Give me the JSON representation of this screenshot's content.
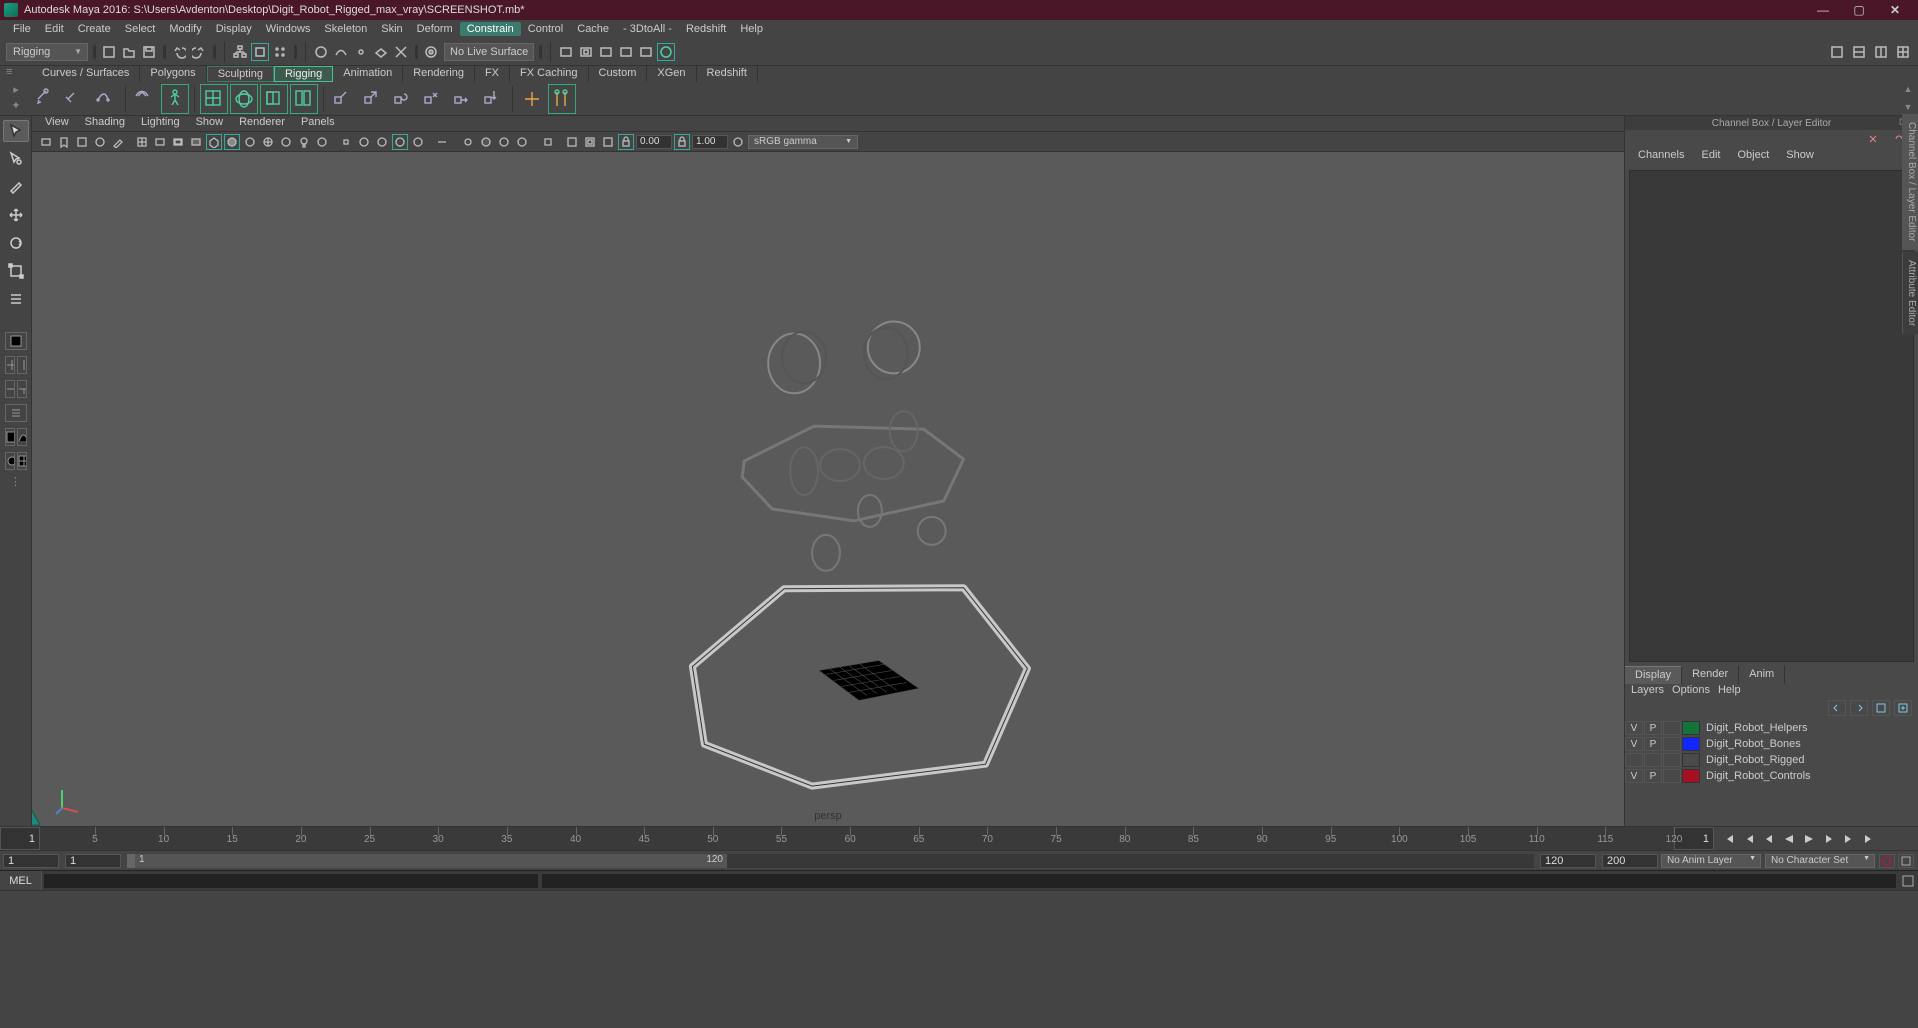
{
  "window": {
    "title": "Autodesk Maya 2016: S:\\Users\\Avdenton\\Desktop\\Digit_Robot_Rigged_max_vray\\SCREENSHOT.mb*"
  },
  "menubar": [
    "File",
    "Edit",
    "Create",
    "Select",
    "Modify",
    "Display",
    "Windows",
    "Skeleton",
    "Skin",
    "Deform",
    "Constrain",
    "Control",
    "Cache",
    "- 3DtoAll -",
    "Redshift",
    "Help"
  ],
  "menubar_highlight": "Constrain",
  "statusline": {
    "workspace": "Rigging",
    "live_surface": "No Live Surface"
  },
  "shelf_tabs": [
    "Curves / Surfaces",
    "Polygons",
    "Sculpting",
    "Rigging",
    "Animation",
    "Rendering",
    "FX",
    "FX Caching",
    "Custom",
    "XGen",
    "Redshift"
  ],
  "shelf_active": "Rigging",
  "vp_menu": [
    "View",
    "Shading",
    "Lighting",
    "Show",
    "Renderer",
    "Panels"
  ],
  "vp_toolbar": {
    "gamma_in": "0.00",
    "gamma_out": "1.00",
    "color_space": "sRGB gamma"
  },
  "camera_label": "persp",
  "channel_box": {
    "title": "Channel Box / Layer Editor",
    "tabs": [
      "Channels",
      "Edit",
      "Object",
      "Show"
    ]
  },
  "layer_editor": {
    "mode_tabs": [
      "Display",
      "Render",
      "Anim"
    ],
    "mode_active": "Display",
    "menu": [
      "Layers",
      "Options",
      "Help"
    ],
    "layers": [
      {
        "v": "V",
        "p": "P",
        "color": "#14733a",
        "name": "Digit_Robot_Helpers"
      },
      {
        "v": "V",
        "p": "P",
        "color": "#1226ff",
        "name": "Digit_Robot_Bones"
      },
      {
        "v": "",
        "p": "",
        "color": "#494949",
        "name": "Digit_Robot_Rigged"
      },
      {
        "v": "V",
        "p": "P",
        "color": "#a51123",
        "name": "Digit_Robot_Controls"
      }
    ]
  },
  "side_tabs": [
    "Channel Box / Layer Editor",
    "Attribute Editor"
  ],
  "timeline": {
    "start_display": "1",
    "end_display": "1",
    "ticks": [
      5,
      10,
      15,
      20,
      25,
      30,
      35,
      40,
      45,
      50,
      55,
      60,
      65,
      70,
      75,
      80,
      85,
      90,
      95,
      100,
      105,
      110,
      115,
      120
    ]
  },
  "range": {
    "start_outer": "1",
    "start_inner": "1",
    "end_inner_label": "120",
    "end_inner": "120",
    "end_outer": "200",
    "anim_layer": "No Anim Layer",
    "char_set": "No Character Set"
  },
  "cmdline": {
    "lang": "MEL"
  }
}
